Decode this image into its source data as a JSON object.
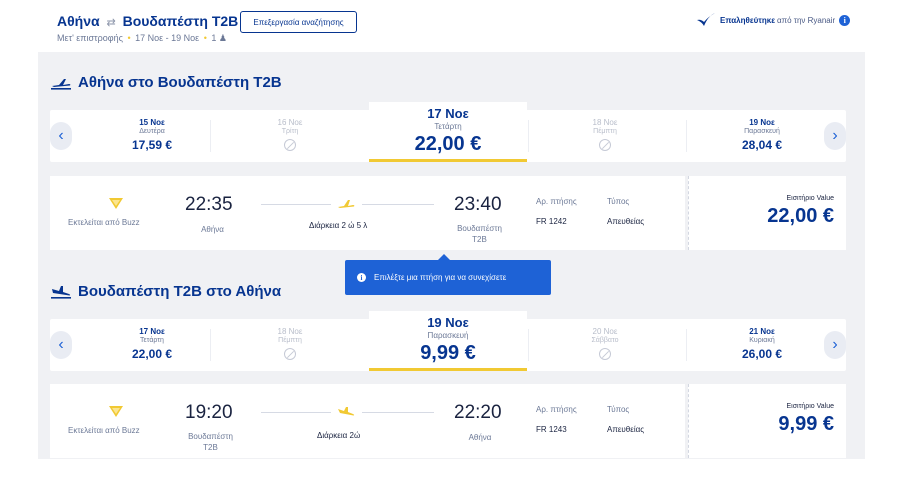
{
  "header": {
    "route_from": "Αθήνα",
    "route_to": "Βουδαπέστη T2B",
    "subtitle_trip": "Μετ' επιστροφής",
    "subtitle_dates": "17 Νοε - 19 Νοε",
    "subtitle_pax": "1",
    "edit_label": "Επεξεργασία αναζήτησης",
    "verified_bold": "Επαληθεύτηκε",
    "verified_rest": "από την Ryanair"
  },
  "outbound": {
    "title": "Αθήνα στο Βουδαπέστη T2B",
    "dates": [
      {
        "date": "15 Νοε",
        "weekday": "Δευτέρα",
        "price": "17,59 €"
      },
      {
        "date": "16 Νοε",
        "weekday": "Τρίτη",
        "price": ""
      },
      {
        "date": "17 Νοε",
        "weekday": "Τετάρτη",
        "price": "22,00 €"
      },
      {
        "date": "18 Νοε",
        "weekday": "Πέμπτη",
        "price": ""
      },
      {
        "date": "19 Νοε",
        "weekday": "Παρασκευή",
        "price": "28,04 €"
      }
    ],
    "flight": {
      "operator": "Εκτελείται από Buzz",
      "dep_time": "22:35",
      "dep_city": "Αθήνα",
      "duration": "Διάρκεια 2 ώ 5 λ",
      "arr_time": "23:40",
      "arr_city_1": "Βουδαπέστη",
      "arr_city_2": "T2B",
      "flight_label": "Αρ. πτήσης",
      "flight_no": "FR 1242",
      "type_label": "Τύπος",
      "type_value": "Απευθείας",
      "fare_label": "Εισιτήριο Value",
      "fare_price": "22,00 €"
    }
  },
  "tooltip": "Επιλέξτε μια πτήση για να συνεχίσετε",
  "inbound": {
    "title": "Βουδαπέστη T2B στο Αθήνα",
    "dates": [
      {
        "date": "17 Νοε",
        "weekday": "Τετάρτη",
        "price": "22,00 €"
      },
      {
        "date": "18 Νοε",
        "weekday": "Πέμπτη",
        "price": ""
      },
      {
        "date": "19 Νοε",
        "weekday": "Παρασκευή",
        "price": "9,99 €"
      },
      {
        "date": "20 Νοε",
        "weekday": "Σάββατο",
        "price": ""
      },
      {
        "date": "21 Νοε",
        "weekday": "Κυριακή",
        "price": "26,00 €"
      }
    ],
    "flight": {
      "operator": "Εκτελείται από Buzz",
      "dep_time": "19:20",
      "dep_city_1": "Βουδαπέστη",
      "dep_city_2": "T2B",
      "duration": "Διάρκεια 2ώ",
      "arr_time": "22:20",
      "arr_city": "Αθήνα",
      "flight_label": "Αρ. πτήσης",
      "flight_no": "FR 1243",
      "type_label": "Τύπος",
      "type_value": "Απευθείας",
      "fare_label": "Εισιτήριο Value",
      "fare_price": "9,99 €"
    }
  },
  "colors": {
    "brand": "#073590",
    "accent": "#f1c933",
    "info": "#1e62d6"
  },
  "icons": [
    "arrows-icon",
    "person-icon",
    "verified-check-icon",
    "info-icon",
    "plane-depart-icon",
    "plane-arrive-icon",
    "chevron-left-icon",
    "chevron-right-icon",
    "no-flights-icon",
    "buzz-logo-icon"
  ]
}
